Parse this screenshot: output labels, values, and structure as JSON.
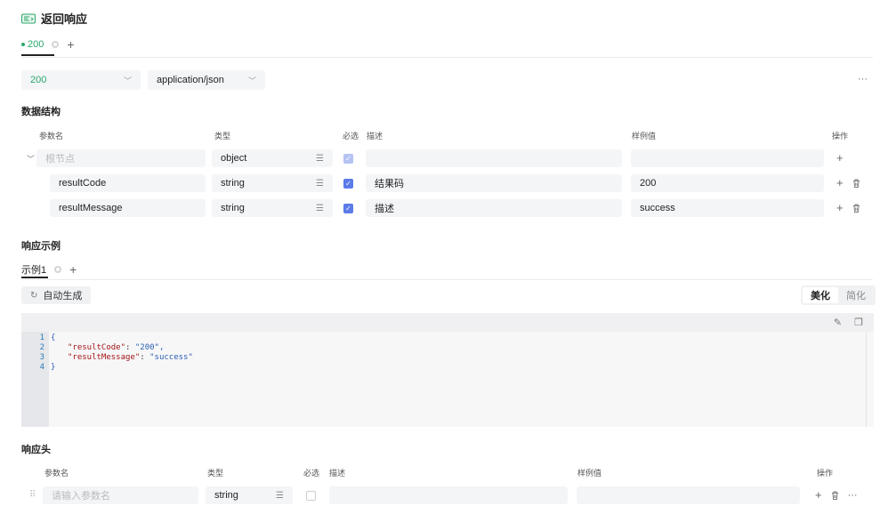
{
  "header": {
    "title": "返回响应"
  },
  "status_tabs": [
    {
      "label": "200"
    }
  ],
  "add_symbol": "+",
  "more_symbol": "···",
  "selects": {
    "status_code": "200",
    "content_type": "application/json"
  },
  "data_structure": {
    "label": "数据结构",
    "columns": {
      "name": "参数名",
      "type": "类型",
      "required": "必选",
      "desc": "描述",
      "example": "样例值",
      "ops": "操作"
    },
    "root": {
      "name_placeholder": "根节点",
      "type": "object"
    },
    "rows": [
      {
        "name": "resultCode",
        "type": "string",
        "desc": "结果码",
        "example": "200"
      },
      {
        "name": "resultMessage",
        "type": "string",
        "desc": "描述",
        "example": "success"
      }
    ]
  },
  "response_example": {
    "label": "响应示例",
    "tab": "示例1",
    "auto_generate": "自动生成",
    "view_modes": {
      "beautify": "美化",
      "simplify": "简化"
    },
    "code_lines": [
      {
        "num": "1",
        "text": "{"
      },
      {
        "num": "2",
        "key": "\"resultCode\"",
        "value": "\"200\","
      },
      {
        "num": "3",
        "key": "\"resultMessage\"",
        "value": "\"success\""
      },
      {
        "num": "4",
        "text": "}"
      }
    ]
  },
  "response_headers": {
    "label": "响应头",
    "columns": {
      "name": "参数名",
      "type": "类型",
      "required": "必选",
      "desc": "描述",
      "example": "样例值",
      "ops": "操作"
    },
    "row": {
      "name_placeholder": "请输入参数名",
      "type": "string"
    }
  },
  "colors": {
    "accent_green": "#2aa86a",
    "checkbox_blue": "#5b7be8"
  }
}
